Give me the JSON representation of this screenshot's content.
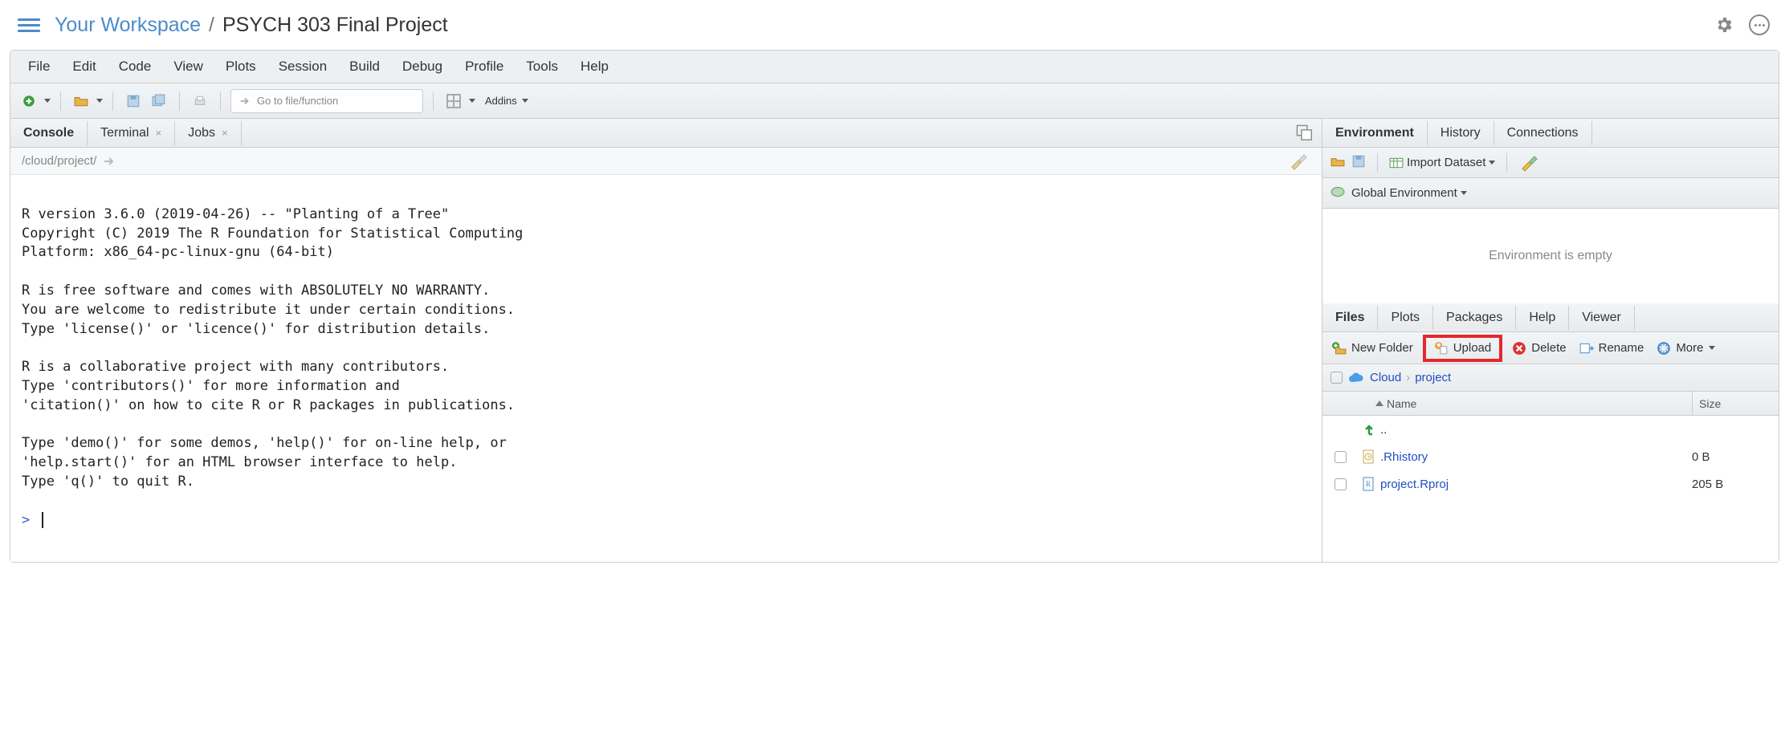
{
  "header": {
    "workspace": "Your Workspace",
    "sep": "/",
    "project": "PSYCH 303 Final Project"
  },
  "menubar": [
    "File",
    "Edit",
    "Code",
    "View",
    "Plots",
    "Session",
    "Build",
    "Debug",
    "Profile",
    "Tools",
    "Help"
  ],
  "toolbar": {
    "goto_placeholder": "Go to file/function",
    "addins": "Addins"
  },
  "left": {
    "tabs": {
      "console": "Console",
      "terminal": "Terminal",
      "jobs": "Jobs"
    },
    "path": "/cloud/project/",
    "console_text": "\nR version 3.6.0 (2019-04-26) -- \"Planting of a Tree\"\nCopyright (C) 2019 The R Foundation for Statistical Computing\nPlatform: x86_64-pc-linux-gnu (64-bit)\n\nR is free software and comes with ABSOLUTELY NO WARRANTY.\nYou are welcome to redistribute it under certain conditions.\nType 'license()' or 'licence()' for distribution details.\n\nR is a collaborative project with many contributors.\nType 'contributors()' for more information and\n'citation()' on how to cite R or R packages in publications.\n\nType 'demo()' for some demos, 'help()' for on-line help, or\n'help.start()' for an HTML browser interface to help.\nType 'q()' to quit R.\n",
    "prompt": ">"
  },
  "env": {
    "tabs": {
      "environment": "Environment",
      "history": "History",
      "connections": "Connections"
    },
    "import": "Import Dataset",
    "global": "Global Environment",
    "empty": "Environment is empty"
  },
  "files": {
    "tabs": {
      "files": "Files",
      "plots": "Plots",
      "packages": "Packages",
      "help": "Help",
      "viewer": "Viewer"
    },
    "btns": {
      "newfolder": "New Folder",
      "upload": "Upload",
      "delete": "Delete",
      "rename": "Rename",
      "more": "More"
    },
    "crumbs": {
      "cloud": "Cloud",
      "project": "project"
    },
    "columns": {
      "name": "Name",
      "size": "Size"
    },
    "rows": [
      {
        "icon": "up",
        "name": "..",
        "size": ""
      },
      {
        "icon": "rhistory",
        "name": ".Rhistory",
        "size": "0 B"
      },
      {
        "icon": "rproj",
        "name": "project.Rproj",
        "size": "205 B"
      }
    ]
  }
}
